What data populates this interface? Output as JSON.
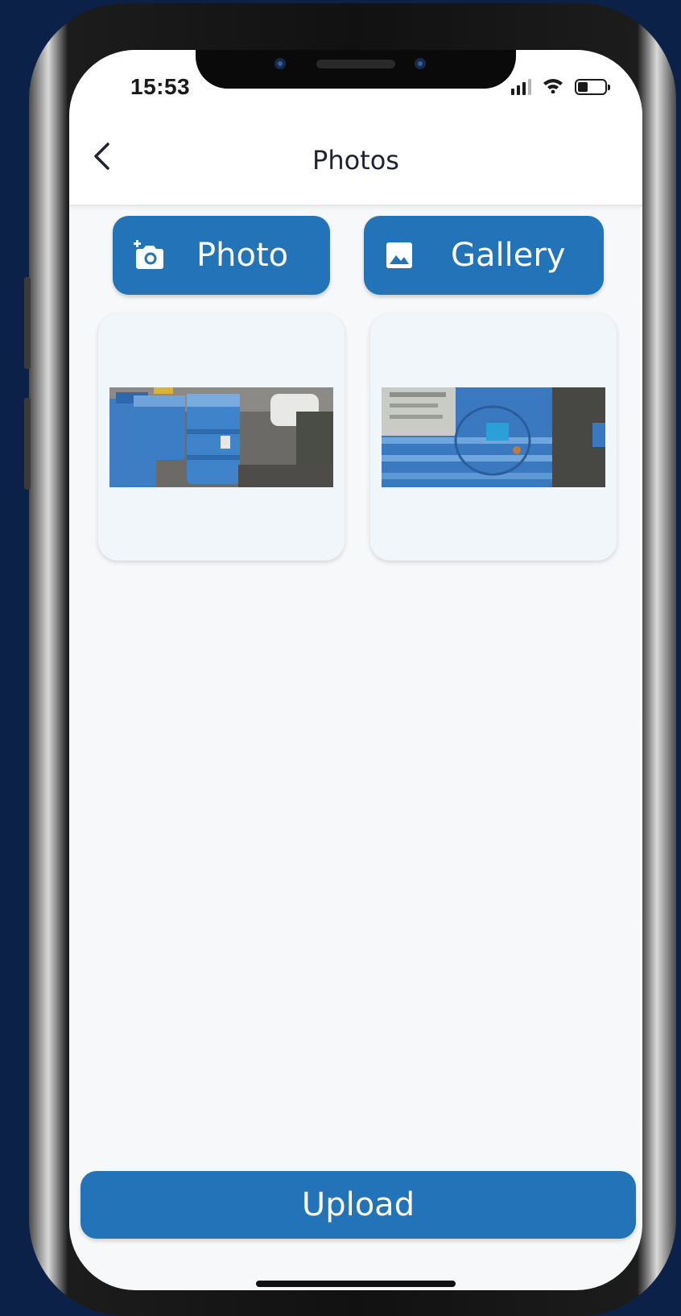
{
  "status_bar": {
    "time": "15:53",
    "icons": [
      "signal-icon",
      "wifi-icon",
      "battery-icon"
    ]
  },
  "header": {
    "title": "Photos",
    "back_icon": "chevron-left-icon"
  },
  "actions": {
    "photo": {
      "label": "Photo",
      "icon": "add-camera-icon"
    },
    "gallery": {
      "label": "Gallery",
      "icon": "image-icon"
    }
  },
  "photos": [
    {
      "name": "photo-thumbnail-1",
      "subject": "blue barrels"
    },
    {
      "name": "photo-thumbnail-2",
      "subject": "blue barrel closeup"
    }
  ],
  "upload": {
    "label": "Upload"
  },
  "colors": {
    "primary": "#2373b9",
    "background": "#0b2148",
    "screen": "#f7f8f9",
    "card": "#f1f6fb"
  }
}
